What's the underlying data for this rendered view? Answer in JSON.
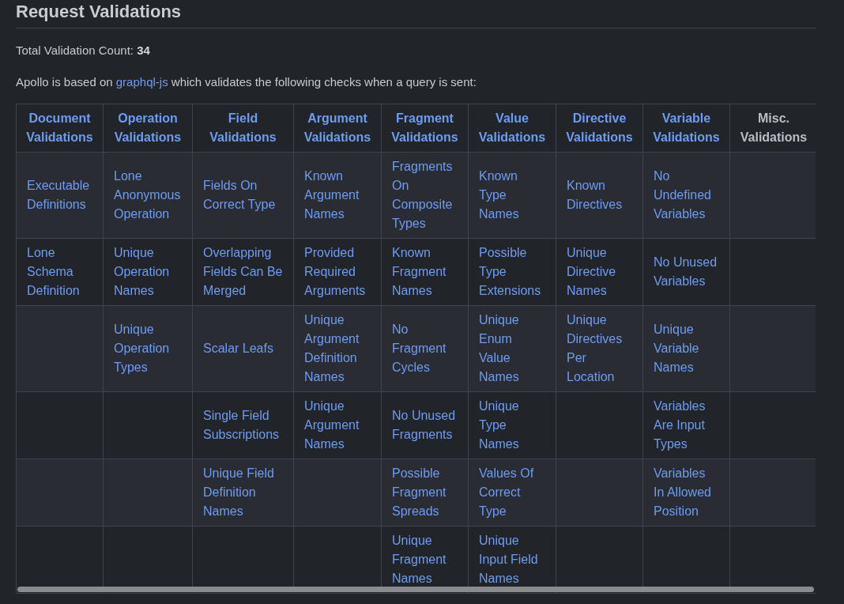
{
  "heading": "Request Validations",
  "total": "Total Validation Count: **34**",
  "intro": {
    "before": "Apollo is based on",
    "link": "graphql-js",
    "after": "which validates the following checks when a query is sent:"
  },
  "table": {
    "columns": [
      {
        "label": "Document Validations",
        "kind": "link"
      },
      {
        "label": "Operation Validations",
        "kind": "link"
      },
      {
        "label": "Field Validations",
        "kind": "link"
      },
      {
        "label": "Argument Validations",
        "kind": "link"
      },
      {
        "label": "Fragment Validations",
        "kind": "link"
      },
      {
        "label": "Value Validations",
        "kind": "link"
      },
      {
        "label": "Directive Validations",
        "kind": "link"
      },
      {
        "label": "Variable Validations",
        "kind": "link"
      },
      {
        "label": "Misc. Validations",
        "kind": "text"
      }
    ],
    "rows": [
      {
        "cells": [
          "Executable Definitions",
          "Lone Anonymous Operation",
          "Fields On Correct Type",
          "Known Argument Names",
          "Fragments On Composite Types",
          "Known Type Names",
          "Known Directives",
          "No Undefined Variables",
          null
        ]
      },
      {
        "cells": [
          "Lone Schema Definition",
          "Unique Operation Names",
          "Overlapping Fields Can Be Merged",
          "Provided Required Arguments",
          "Known Fragment Names",
          "Possible Type Extensions",
          "Unique Directive Names",
          "No Unused Variables",
          null
        ]
      },
      {
        "cells": [
          null,
          "Unique Operation Types",
          "Scalar Leafs",
          "Unique Argument Definition Names",
          "No Fragment Cycles",
          "Unique Enum Value Names",
          "Unique Directives Per Location",
          "Unique Variable Names",
          null
        ]
      },
      {
        "cells": [
          null,
          null,
          "Single Field Subscriptions",
          "Unique Argument Names",
          "No Unused Fragments",
          "Unique Type Names",
          null,
          "Variables Are Input Types",
          null
        ]
      },
      {
        "cells": [
          null,
          null,
          "Unique Field Definition Names",
          null,
          "Possible Fragment Spreads",
          "Values Of Correct Type",
          null,
          "Variables In Allowed Position",
          null
        ]
      },
      {
        "cells": [
          null,
          null,
          null,
          null,
          "Unique Fragment Names",
          "Unique Input Field Names",
          null,
          null,
          null
        ]
      }
    ]
  }
}
